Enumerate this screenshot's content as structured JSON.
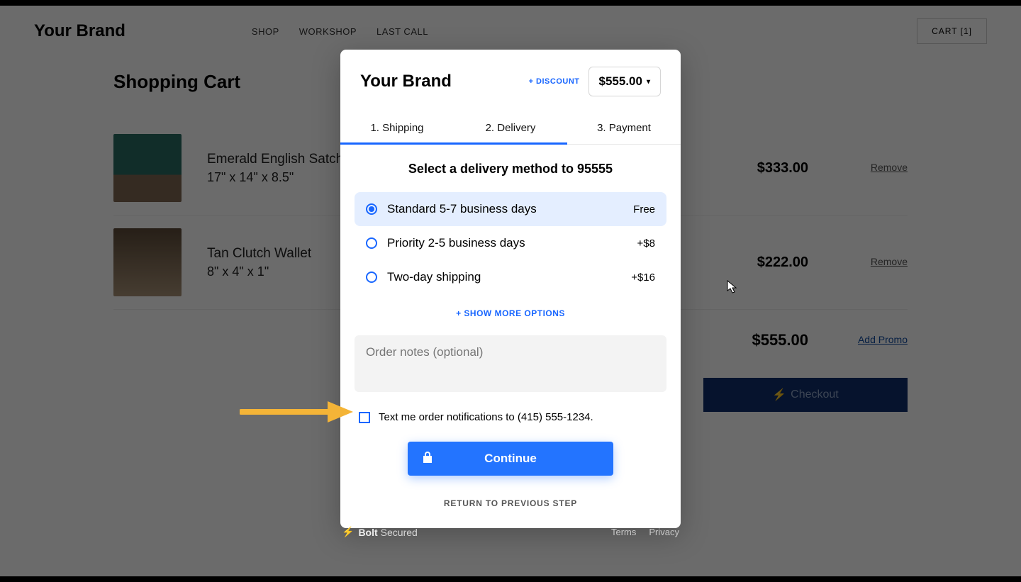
{
  "header": {
    "brand": "Your Brand",
    "nav": [
      "SHOP",
      "WORKSHOP",
      "LAST CALL"
    ],
    "cart_label": "CART [1]"
  },
  "cart": {
    "title": "Shopping Cart",
    "items": [
      {
        "name": "Emerald English Satchel",
        "dims": "17\" x 14\" x 8.5\"",
        "price": "$333.00",
        "remove": "Remove"
      },
      {
        "name": "Tan Clutch Wallet",
        "dims": "8\" x 4\" x 1\"",
        "price": "$222.00",
        "remove": "Remove"
      }
    ],
    "total": "$555.00",
    "promo": "Add Promo",
    "checkout": "Checkout"
  },
  "modal": {
    "brand": "Your Brand",
    "discount": "+ DISCOUNT",
    "total": "$555.00",
    "tabs": [
      "1. Shipping",
      "2. Delivery",
      "3. Payment"
    ],
    "title": "Select a delivery method to 95555",
    "options": [
      {
        "label": "Standard 5-7 business days",
        "price": "Free",
        "selected": true
      },
      {
        "label": "Priority 2-5 business days",
        "price": "+$8",
        "selected": false
      },
      {
        "label": "Two-day shipping",
        "price": "+$16",
        "selected": false
      }
    ],
    "more": "+ SHOW MORE OPTIONS",
    "notes_placeholder": "Order notes (optional)",
    "sms": "Text me order notifications to (415) 555-1234.",
    "continue": "Continue",
    "return": "RETURN TO PREVIOUS STEP"
  },
  "footer": {
    "bolt": "Bolt",
    "secured": "Secured",
    "terms": "Terms",
    "privacy": "Privacy"
  }
}
